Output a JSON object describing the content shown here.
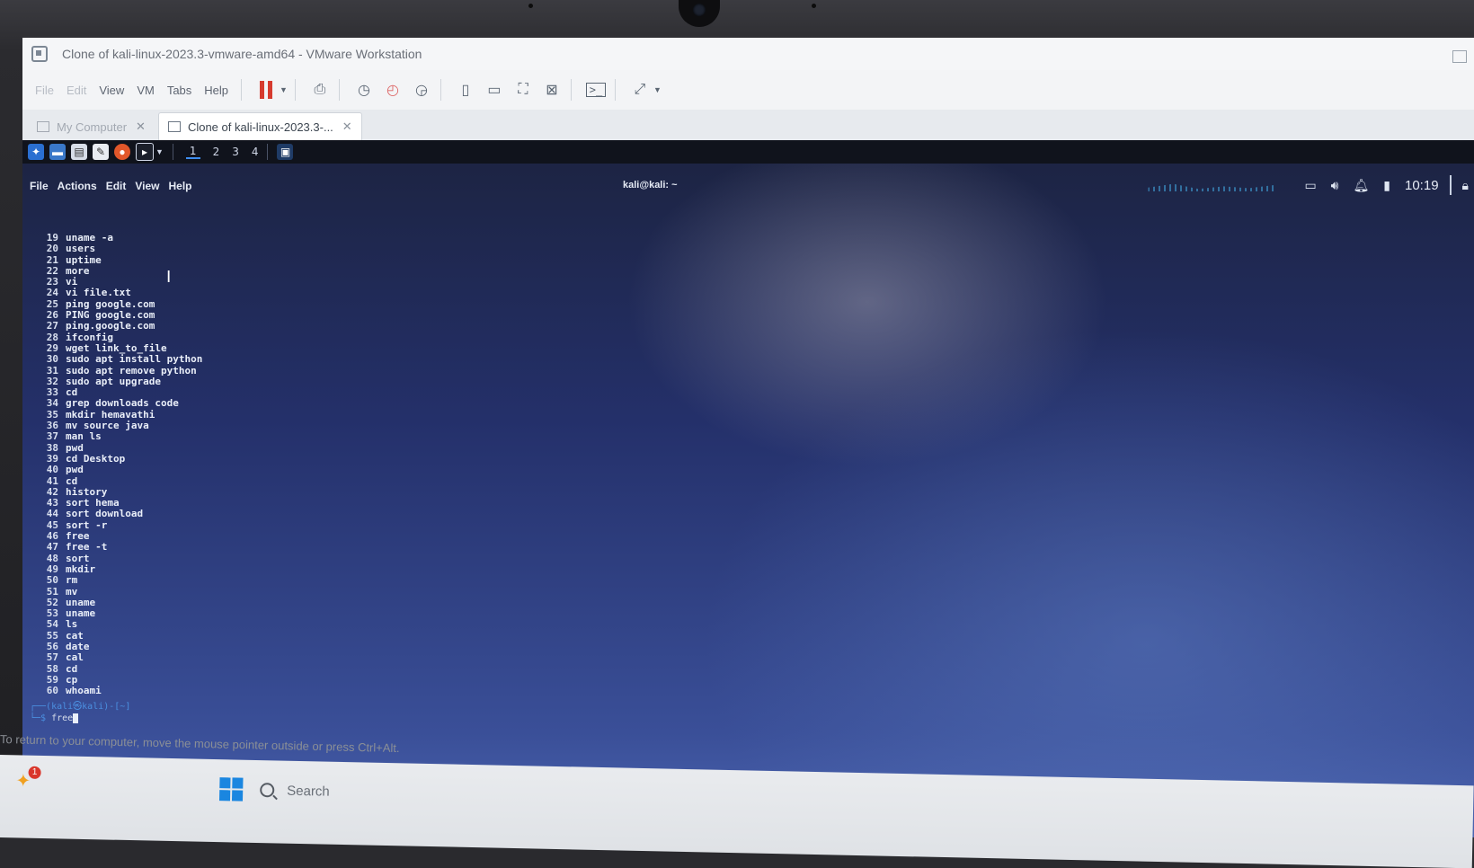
{
  "window": {
    "title": "Clone of kali-linux-2023.3-vmware-amd64 - VMware Workstation"
  },
  "menu": {
    "file": "File",
    "edit": "Edit",
    "view": "View",
    "vm": "VM",
    "tabs": "Tabs",
    "help": "Help"
  },
  "tabs": {
    "my_computer": "My Computer",
    "clone": "Clone of kali-linux-2023.3-..."
  },
  "panel": {
    "workspaces": [
      "1",
      "2",
      "3",
      "4"
    ],
    "clock": "10:19"
  },
  "terminal": {
    "title": "kali@kali: ~",
    "menu": {
      "file": "File",
      "actions": "Actions",
      "edit": "Edit",
      "view": "View",
      "help": "Help"
    },
    "history": [
      {
        "n": "19",
        "cmd": "uname -a"
      },
      {
        "n": "20",
        "cmd": "users"
      },
      {
        "n": "21",
        "cmd": "uptime"
      },
      {
        "n": "22",
        "cmd": "more"
      },
      {
        "n": "23",
        "cmd": "vi"
      },
      {
        "n": "24",
        "cmd": "vi file.txt"
      },
      {
        "n": "25",
        "cmd": "ping google.com"
      },
      {
        "n": "26",
        "cmd": "PING google.com"
      },
      {
        "n": "27",
        "cmd": "ping.google.com"
      },
      {
        "n": "28",
        "cmd": "ifconfig"
      },
      {
        "n": "29",
        "cmd": "wget link_to_file"
      },
      {
        "n": "30",
        "cmd": "sudo apt install python"
      },
      {
        "n": "31",
        "cmd": "sudo apt remove python"
      },
      {
        "n": "32",
        "cmd": "sudo apt upgrade"
      },
      {
        "n": "33",
        "cmd": "cd"
      },
      {
        "n": "34",
        "cmd": "grep downloads code"
      },
      {
        "n": "35",
        "cmd": "mkdir hemavathi"
      },
      {
        "n": "36",
        "cmd": "mv source java"
      },
      {
        "n": "37",
        "cmd": "man ls"
      },
      {
        "n": "38",
        "cmd": "pwd"
      },
      {
        "n": "39",
        "cmd": "cd Desktop"
      },
      {
        "n": "40",
        "cmd": "pwd"
      },
      {
        "n": "41",
        "cmd": "cd"
      },
      {
        "n": "42",
        "cmd": "history"
      },
      {
        "n": "43",
        "cmd": "sort hema"
      },
      {
        "n": "44",
        "cmd": "sort download"
      },
      {
        "n": "45",
        "cmd": "sort -r"
      },
      {
        "n": "46",
        "cmd": "free"
      },
      {
        "n": "47",
        "cmd": "free -t"
      },
      {
        "n": "48",
        "cmd": "sort"
      },
      {
        "n": "49",
        "cmd": "mkdir"
      },
      {
        "n": "50",
        "cmd": "rm"
      },
      {
        "n": "51",
        "cmd": "mv"
      },
      {
        "n": "52",
        "cmd": "uname"
      },
      {
        "n": "53",
        "cmd": "uname"
      },
      {
        "n": "54",
        "cmd": "ls"
      },
      {
        "n": "55",
        "cmd": "cat"
      },
      {
        "n": "56",
        "cmd": "date"
      },
      {
        "n": "57",
        "cmd": "cal"
      },
      {
        "n": "58",
        "cmd": "cd"
      },
      {
        "n": "59",
        "cmd": "cp"
      },
      {
        "n": "60",
        "cmd": "whoami"
      }
    ],
    "prompt_line1": "┌──(kali㉿kali)-[~]",
    "prompt_line2_prefix": "└─$ ",
    "current_input": "free"
  },
  "host": {
    "hint": "To return to your computer, move the mouse pointer outside or press Ctrl+Alt.",
    "notification_count": "1",
    "search_label": "Search"
  },
  "colors": {
    "pause_red": "#d63b2f",
    "kali_blue": "#3f8ef0",
    "windows_blue": "#1a86e0"
  }
}
